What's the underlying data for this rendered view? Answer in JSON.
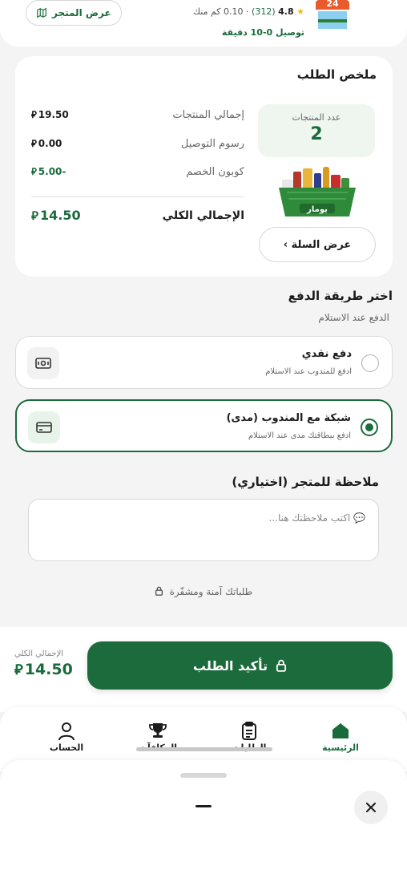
{
  "store": {
    "rating": "4.8",
    "reviews": "(312)",
    "distance": "· 0.10 كم منك",
    "delivery": "توصيل 0-10 دقيقة",
    "logo_number": "24",
    "view_store_label": "عرض المتجر"
  },
  "summary": {
    "title": "ملخص الطلب",
    "items_count_label": "عدد المنتجات",
    "items_count": "2",
    "basket_brand": "يومار",
    "view_cart_label": "عرض السلة ›",
    "lines": [
      {
        "label": "إجمالي المنتجات",
        "amount": "19.50"
      },
      {
        "label": "رسوم التوصيل",
        "amount": "0.00"
      },
      {
        "label": "كوبون الخصم",
        "amount": "5.00-"
      }
    ],
    "total_label": "الإجمالي الكلي",
    "total_amount": "14.50",
    "currency_symbol": "⃁"
  },
  "payment": {
    "title": "اختر طريقة الدفع",
    "subtitle": "الدفع عند الاستلام",
    "options": [
      {
        "title": "دفع نقدي",
        "subtitle": "ادفع للمندوب عند الاستلام",
        "selected": false,
        "icon": "cash-icon"
      },
      {
        "title": "شبكة مع المندوب (مدى)",
        "subtitle": "ادفع ببطاقتك مدى عند الاستلام",
        "selected": true,
        "icon": "card-icon"
      }
    ]
  },
  "note": {
    "title": "ملاحظة للمتجر (اختياري)",
    "placeholder": "💬 اكتب ملاحظتك هنا..."
  },
  "secure_text": "طلباتك آمنة ومشفّرة",
  "checkout": {
    "confirm_label": "تأكيد الطلب",
    "total_label": "الإجمالي الكلي",
    "total_amount": "14.50"
  },
  "tabs": [
    {
      "label": "الرئيسية",
      "icon": "home-icon",
      "active": true
    },
    {
      "label": "الطلبات",
      "icon": "orders-icon",
      "active": false
    },
    {
      "label": "المكافآت",
      "icon": "trophy-icon",
      "active": false
    },
    {
      "label": "الحساب",
      "icon": "user-icon",
      "active": false
    }
  ],
  "colors": {
    "primary": "#1C6B3C",
    "accent_light": "#EEF6EF",
    "star": "#F2B81B",
    "background": "#F4F4F4"
  }
}
